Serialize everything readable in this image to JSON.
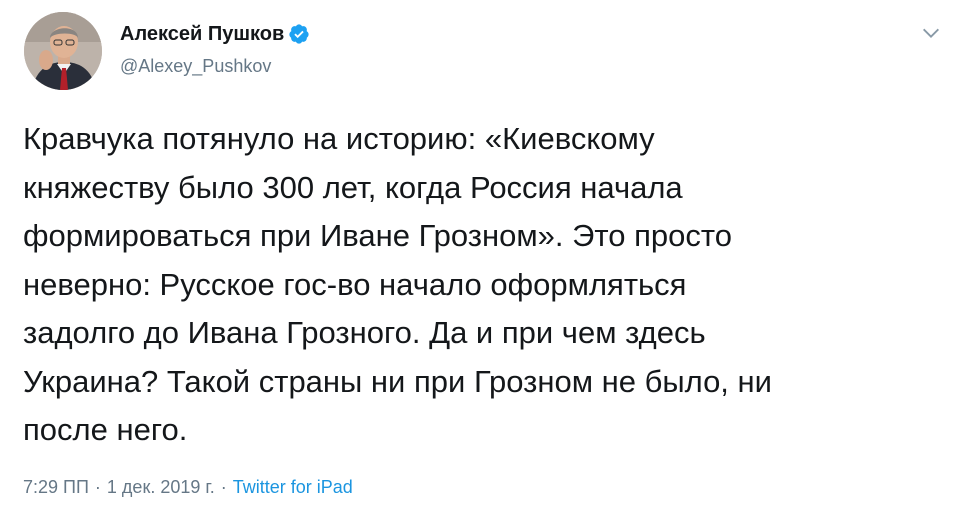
{
  "author": {
    "name": "Алексей Пушков",
    "handle": "@Alexey_Pushkov",
    "verified": true,
    "avatar_icon": "profile-photo"
  },
  "tweet": {
    "text": "Кравчука потянуло на историю: «Киевскому\nкняжеству было 300 лет, когда Россия начала\nформироваться при Иване Грозном». Это просто\nневерно: Русское гос-во начало оформляться\nзадолго до Ивана Грозного. Да и при чем здесь\nУкраина? Такой страны ни при Грозном не было, ни\nпосле него."
  },
  "meta": {
    "time": "7:29 ПП",
    "separator": "·",
    "date": "1 дек. 2019 г.",
    "source": "Twitter for iPad"
  },
  "colors": {
    "verified": "#1da1f2",
    "secondary_text": "#657786",
    "link": "#1b95e0"
  },
  "icons": {
    "verified": "verified-badge-icon",
    "menu": "chevron-down-icon"
  }
}
